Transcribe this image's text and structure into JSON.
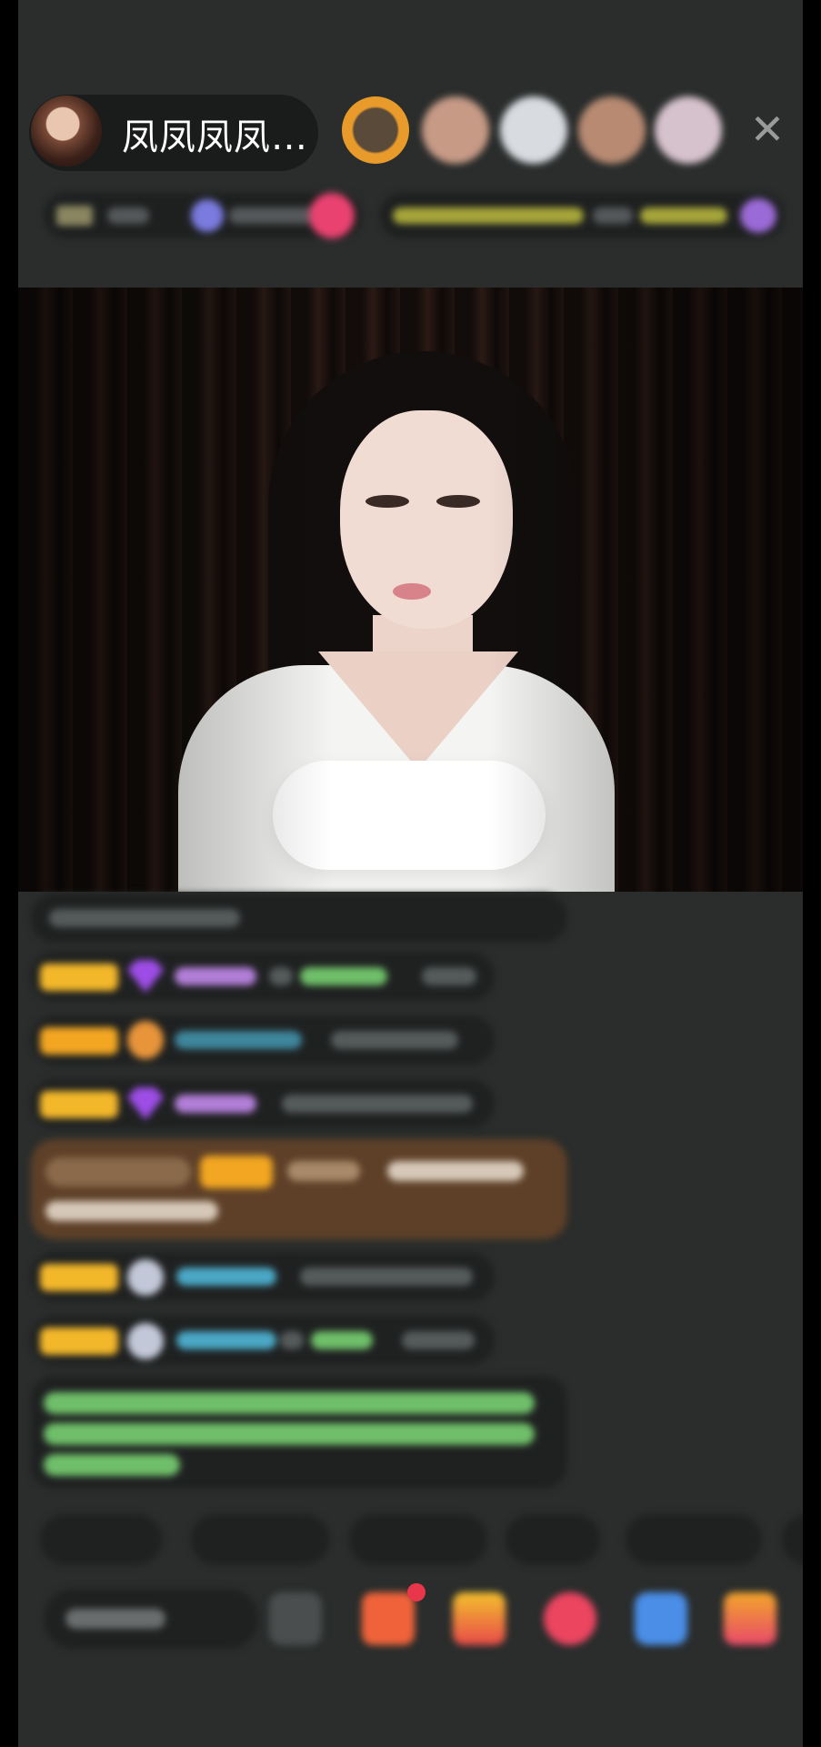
{
  "stream": {
    "host_name": "凤凤凤凤…",
    "close_symbol": "✕"
  },
  "icons": {
    "close": "close-icon",
    "gift": "gift-icon",
    "emoji": "emoji-icon",
    "more": "more-icon"
  },
  "colors": {
    "background": "#2a2d2c",
    "badge_yellow": "#f3b72a",
    "username_blue": "#4aa8c6",
    "system_green": "#6fbf6a",
    "gift_bg": "#5e4028"
  }
}
